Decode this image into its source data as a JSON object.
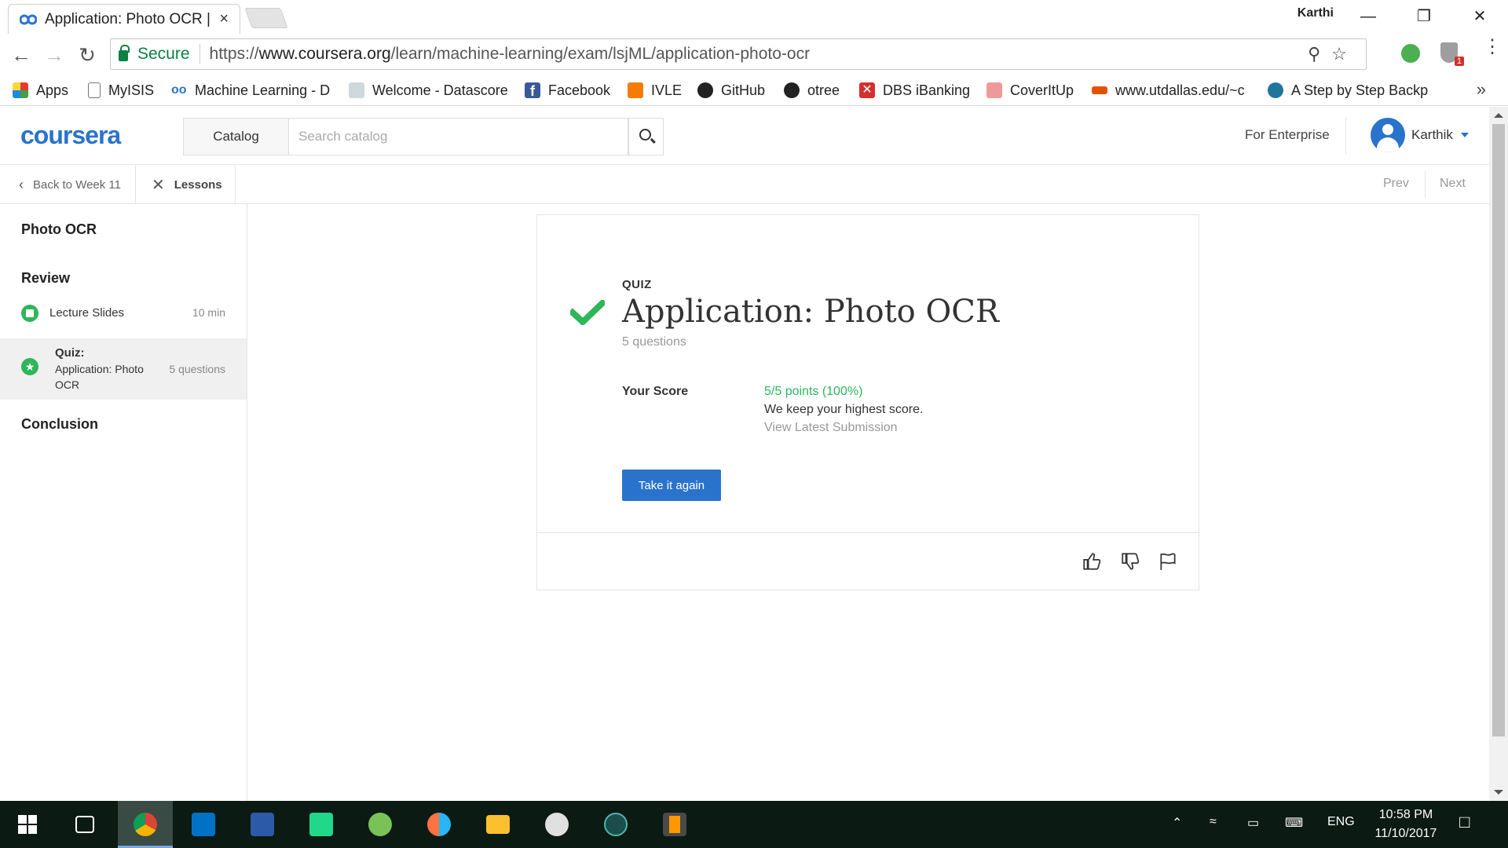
{
  "browser": {
    "tab_title": "Application: Photo OCR |",
    "tab_close": "×",
    "profile_name": "Karthi",
    "secure_label": "Secure",
    "url_scheme": "https://",
    "url_domain": "www.coursera.org",
    "url_path": "/learn/machine-learning/exam/lsjML/application-photo-ocr",
    "extension_badge": "1"
  },
  "bookmarks": [
    {
      "label": "Apps",
      "color": "#e53935"
    },
    {
      "label": "MyISIS",
      "color": "#9e9e9e"
    },
    {
      "label": "Machine Learning - D",
      "color": "#2a73cc"
    },
    {
      "label": "Welcome - Datascore",
      "color": "#90a4ae"
    },
    {
      "label": "Facebook",
      "color": "#3b5998"
    },
    {
      "label": "IVLE",
      "color": "#f57c00"
    },
    {
      "label": "GitHub",
      "color": "#222222"
    },
    {
      "label": "otree",
      "color": "#222222"
    },
    {
      "label": "DBS iBanking",
      "color": "#d32f2f"
    },
    {
      "label": "CoverItUp",
      "color": "#e57373"
    },
    {
      "label": "www.utdallas.edu/~c",
      "color": "#e65100"
    },
    {
      "label": "A Step by Step Backp",
      "color": "#21759b"
    }
  ],
  "header": {
    "logo": "coursera",
    "catalog_label": "Catalog",
    "search_placeholder": "Search catalog",
    "enterprise_label": "For Enterprise",
    "user_name": "Karthik"
  },
  "lesson_nav": {
    "back_label": "Back to Week 11",
    "lessons_label": "Lessons",
    "prev_label": "Prev",
    "next_label": "Next"
  },
  "sidebar": {
    "sections": {
      "photo_ocr": "Photo OCR",
      "review": "Review",
      "conclusion": "Conclusion"
    },
    "items": [
      {
        "label": "Lecture Slides",
        "meta": "10 min"
      },
      {
        "kind": "Quiz:",
        "label": "Application: Photo OCR",
        "meta": "5 questions"
      }
    ]
  },
  "quiz": {
    "type_label": "QUIZ",
    "title": "Application: Photo OCR",
    "question_count": "5 questions",
    "score_label": "Your Score",
    "score_value": "5/5 points (100%)",
    "keep_note": "We keep your highest score.",
    "view_latest": "View Latest Submission",
    "retake_button": "Take it again"
  },
  "taskbar": {
    "language": "ENG",
    "time": "10:58 PM",
    "date": "11/10/2017"
  },
  "colors": {
    "brand_blue": "#2a73cc",
    "success_green": "#2eb65a"
  }
}
